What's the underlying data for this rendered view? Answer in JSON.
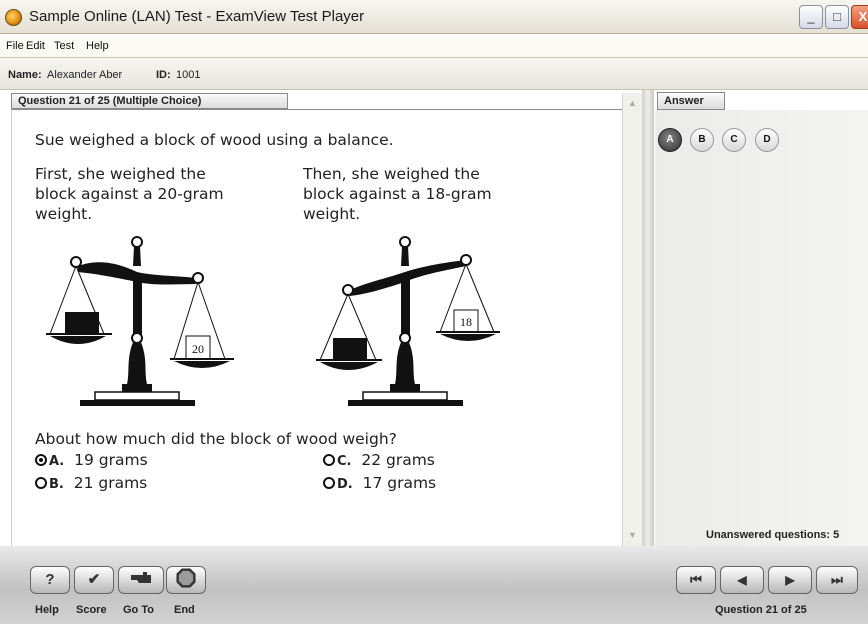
{
  "window": {
    "title": "Sample Online (LAN) Test - ExamView Test Player",
    "controls": {
      "minimize": "_",
      "maximize": "□",
      "close": "X"
    }
  },
  "menu": [
    "File",
    "Edit",
    "Test",
    "Help"
  ],
  "student": {
    "name_label": "Name:",
    "name": "Alexander Aber",
    "id_label": "ID:",
    "id": "1001"
  },
  "question": {
    "header": "Question 21 of 25 (Multiple Choice)",
    "stem": "Sue weighed a block of wood using a balance.",
    "left_caption": [
      "First, she weighed the",
      "block against a 20-gram",
      "weight."
    ],
    "right_caption": [
      "Then, she weighed the",
      "block against a 18-gram",
      "weight."
    ],
    "left_weight_label": "20",
    "right_weight_label": "18",
    "prompt": "About how much did the block of wood weigh?",
    "choices": [
      {
        "letter": "A.",
        "text": "19 grams",
        "selected": true
      },
      {
        "letter": "B.",
        "text": "21 grams",
        "selected": false
      },
      {
        "letter": "C.",
        "text": "22 grams",
        "selected": false
      },
      {
        "letter": "D.",
        "text": "17 grams",
        "selected": false
      }
    ]
  },
  "answer_panel": {
    "tab": "Answer",
    "options": [
      "A",
      "B",
      "C",
      "D"
    ],
    "selected": "A",
    "unanswered": "Unanswered questions: 5"
  },
  "toolbar": {
    "help_icon": "?",
    "score_icon": "✔",
    "labels": [
      "Help",
      "Score",
      "Go To",
      "End"
    ]
  },
  "navigation": {
    "first": "⏮",
    "prev": "◀",
    "next": "▶",
    "last": "⏭",
    "status": "Question 21 of 25"
  },
  "colors": {
    "selected_answer": "#2a2a2a",
    "close_button": "#d9502a"
  }
}
